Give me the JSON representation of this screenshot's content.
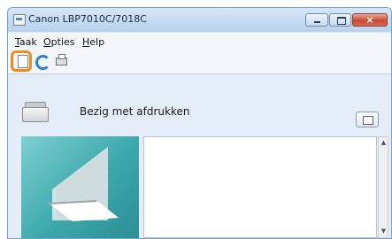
{
  "window": {
    "title": "Canon LBP7010C/7018C",
    "buttons": {
      "minimize": "minimize",
      "maximize": "maximize",
      "close": "×"
    }
  },
  "menu": {
    "items": [
      {
        "accel": "T",
        "rest": "aak"
      },
      {
        "accel": "O",
        "rest": "pties"
      },
      {
        "accel": "H",
        "rest": "elp"
      }
    ]
  },
  "toolbar": {
    "icons": [
      "page-icon",
      "refresh-icon",
      "printer-settings-icon"
    ],
    "highlight_color": "#f08a1c"
  },
  "status": {
    "text": "Bezig met afdrukken"
  },
  "scroll": {
    "up": "▲",
    "down": "▼"
  },
  "colors": {
    "titlebar": "#c7dbf2",
    "panel_teal": "#3ca8ac",
    "close_red": "#c74a35"
  }
}
